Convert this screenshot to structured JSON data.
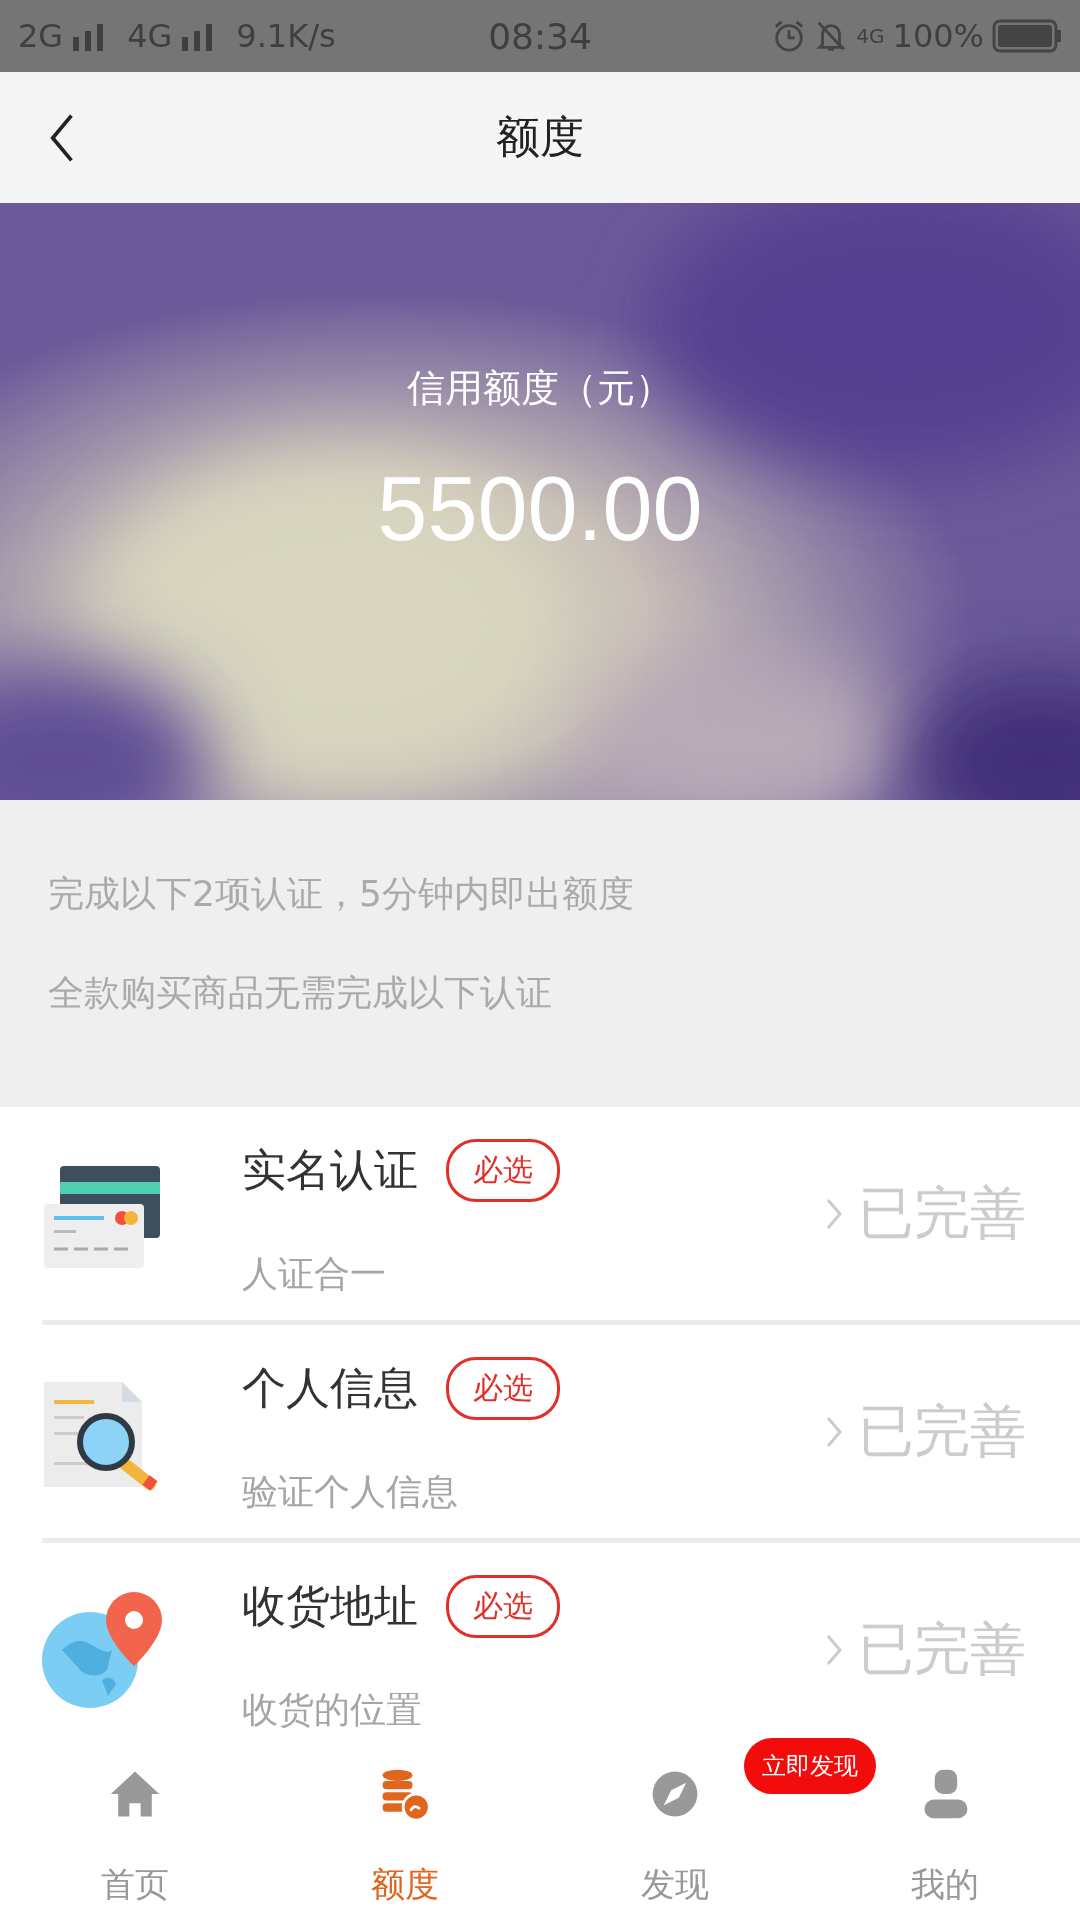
{
  "status_bar": {
    "left": [
      "2G",
      "4G"
    ],
    "speed": "9.1K/s",
    "time": "08:34",
    "network": "4G",
    "battery": "100%"
  },
  "header": {
    "title": "额度"
  },
  "banner": {
    "label": "信用额度（元）",
    "amount": "5500.00"
  },
  "notes": [
    "完成以下2项认证，5分钟内即出额度",
    "全款购买商品无需完成以下认证"
  ],
  "items": [
    {
      "kind": "card",
      "title": "实名认证",
      "badge": "必选",
      "subtitle": "人证合一",
      "status": "已完善"
    },
    {
      "kind": "search",
      "title": "个人信息",
      "badge": "必选",
      "subtitle": "验证个人信息",
      "status": "已完善"
    },
    {
      "kind": "globe",
      "title": "收货地址",
      "badge": "必选",
      "subtitle": "收货的位置",
      "status": "已完善"
    }
  ],
  "tabs": [
    {
      "kind": "home",
      "label": "首页",
      "selected": false
    },
    {
      "kind": "coins",
      "label": "额度",
      "selected": true
    },
    {
      "kind": "compass",
      "label": "发现",
      "selected": false,
      "badge": "立即发现"
    },
    {
      "kind": "user",
      "label": "我的",
      "selected": false
    }
  ]
}
